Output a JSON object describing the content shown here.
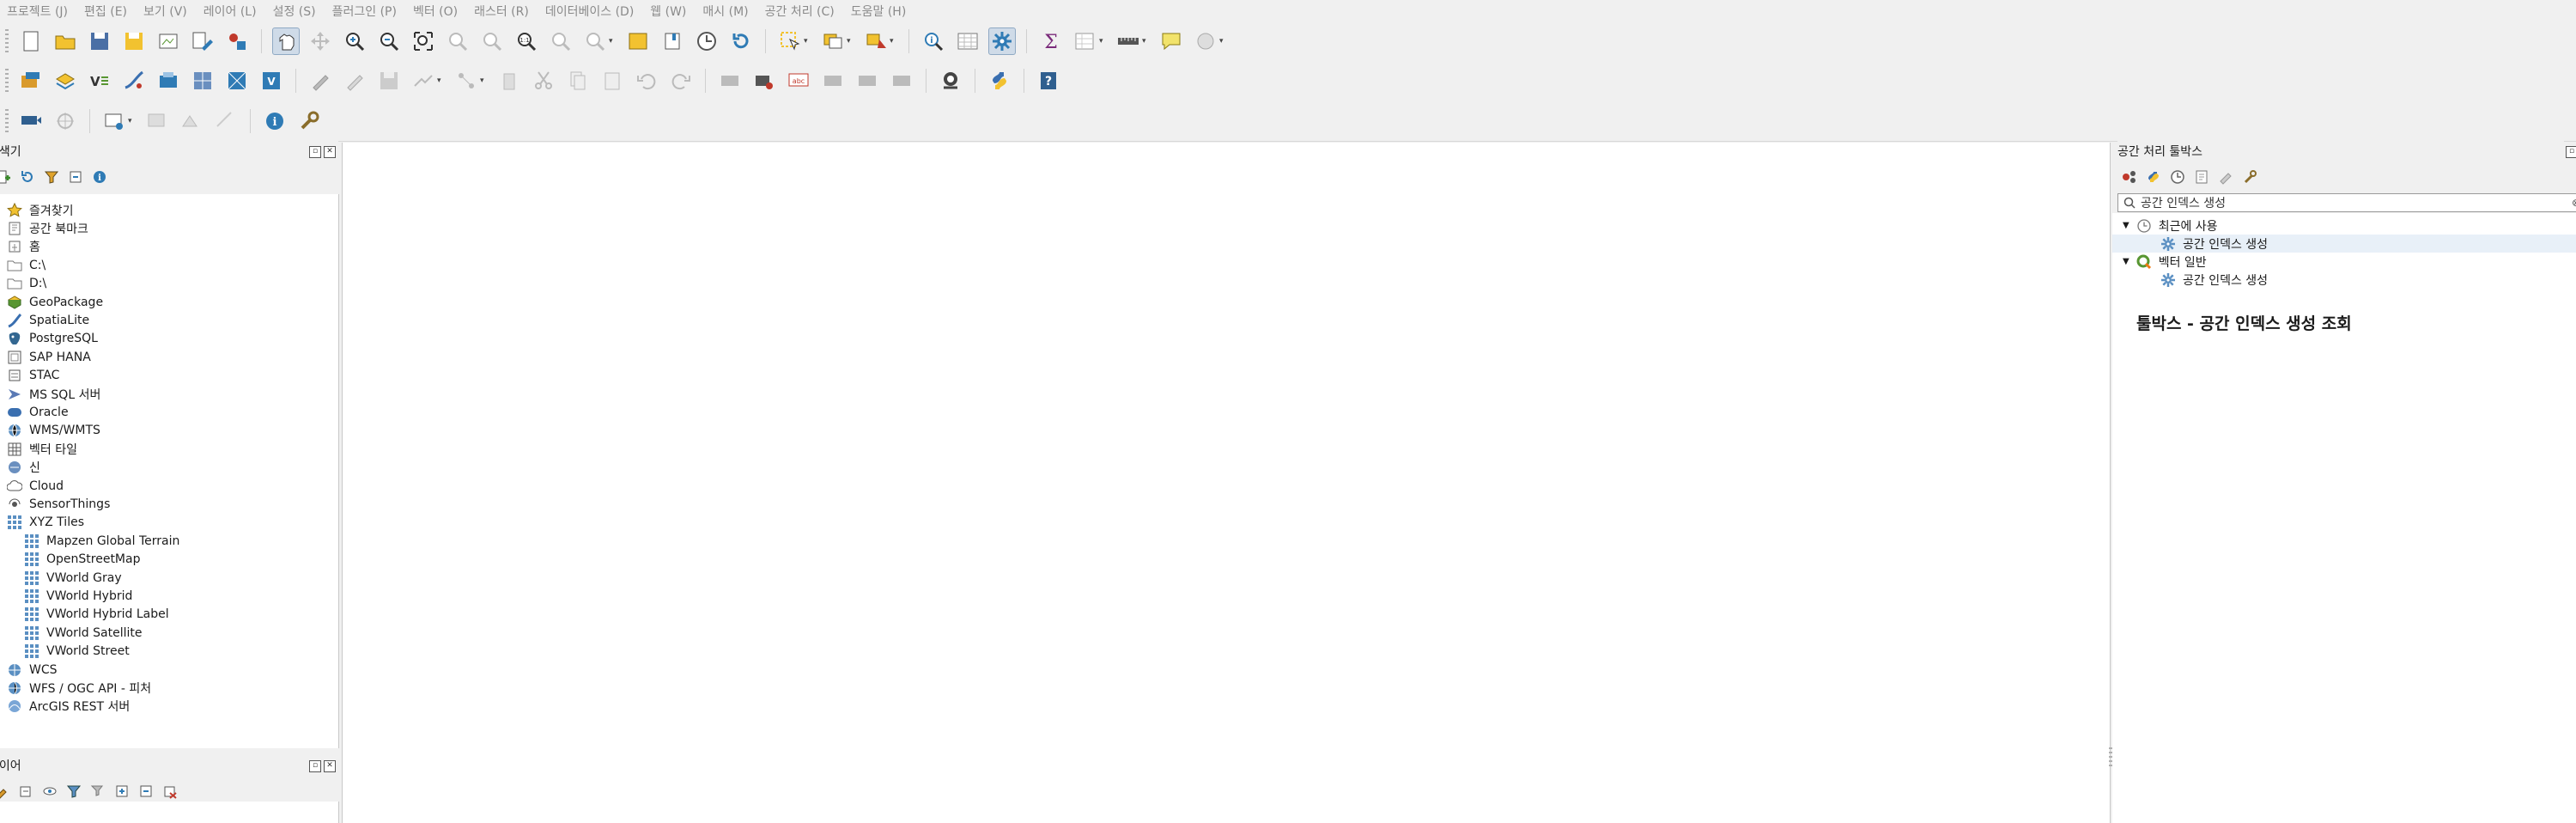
{
  "menubar": {
    "items": [
      "프로젝트 (J)",
      "편집 (E)",
      "보기 (V)",
      "레이어 (L)",
      "설정 (S)",
      "플러그인 (P)",
      "벡터 (O)",
      "래스터 (R)",
      "데이터베이스 (D)",
      "웹 (W)",
      "매시 (M)",
      "공간 처리 (C)",
      "도움말 (H)"
    ]
  },
  "toolbar_icons": {
    "row1": [
      "new-project",
      "open-project",
      "save-project",
      "save-as",
      "print-layout",
      "layout-manager",
      "style-manager",
      "pan-map",
      "pan-to-selection",
      "zoom-in",
      "zoom-out",
      "zoom-full",
      "zoom-to-selection",
      "zoom-to-layer",
      "zoom-native",
      "zoom-last",
      "zoom-next",
      "new-bookmark",
      "show-bookmarks",
      "temporal-controller",
      "refresh",
      "select-features",
      "deselect",
      "select-by-location",
      "identify",
      "attribute-table",
      "processing-toolbox",
      "statistical-summary",
      "open-table",
      "measure",
      "map-tips",
      "annotation"
    ],
    "row2": [
      "data-source-manager",
      "add-vector-layer",
      "add-delimited-text",
      "add-spatialite",
      "add-virtual-layer",
      "add-raster",
      "add-mesh",
      "add-wms",
      "current-edits",
      "toggle-editing",
      "save-edits",
      "digitize",
      "vertex-tool",
      "delete-selected",
      "cut",
      "copy",
      "paste",
      "undo",
      "redo",
      "label-tool",
      "pin-labels",
      "show-labels",
      "move-label",
      "rotate-label",
      "change-label",
      "qgis-online",
      "python-console",
      "help"
    ],
    "row3": [
      "move-feature",
      "rotate",
      "add-ring",
      "add-part",
      "fill-ring",
      "split",
      "information",
      "settings-tool"
    ]
  },
  "browser": {
    "title": "탐색기",
    "items": [
      {
        "label": "즐겨찾기",
        "icon": "star-icon",
        "indent": 0
      },
      {
        "label": "공간 북마크",
        "icon": "bookmark-icon",
        "indent": 0
      },
      {
        "label": "홈",
        "icon": "home-icon",
        "indent": 0
      },
      {
        "label": "C:\\",
        "icon": "folder-icon",
        "indent": 0
      },
      {
        "label": "D:\\",
        "icon": "folder-icon",
        "indent": 0
      },
      {
        "label": "GeoPackage",
        "icon": "geopackage-icon",
        "indent": 0
      },
      {
        "label": "SpatiaLite",
        "icon": "spatialite-icon",
        "indent": 0
      },
      {
        "label": "PostgreSQL",
        "icon": "postgresql-icon",
        "indent": 0
      },
      {
        "label": "SAP HANA",
        "icon": "sap-hana-icon",
        "indent": 0
      },
      {
        "label": "STAC",
        "icon": "stac-icon",
        "indent": 0
      },
      {
        "label": "MS SQL 서버",
        "icon": "mssql-icon",
        "indent": 0
      },
      {
        "label": "Oracle",
        "icon": "oracle-icon",
        "indent": 0
      },
      {
        "label": "WMS/WMTS",
        "icon": "wms-icon",
        "indent": 0
      },
      {
        "label": "벡터 타일",
        "icon": "vector-tile-icon",
        "indent": 0
      },
      {
        "label": "신",
        "icon": "scene-icon",
        "indent": 0
      },
      {
        "label": "Cloud",
        "icon": "cloud-icon",
        "indent": 0
      },
      {
        "label": "SensorThings",
        "icon": "sensorthings-icon",
        "indent": 0
      },
      {
        "label": "XYZ Tiles",
        "icon": "xyz-tiles-icon",
        "indent": 0
      },
      {
        "label": "Mapzen Global Terrain",
        "icon": "xyz-tiles-icon",
        "indent": 1
      },
      {
        "label": "OpenStreetMap",
        "icon": "xyz-tiles-icon",
        "indent": 1
      },
      {
        "label": "VWorld Gray",
        "icon": "xyz-tiles-icon",
        "indent": 1
      },
      {
        "label": "VWorld Hybrid",
        "icon": "xyz-tiles-icon",
        "indent": 1
      },
      {
        "label": "VWorld Hybrid Label",
        "icon": "xyz-tiles-icon",
        "indent": 1
      },
      {
        "label": "VWorld Satellite",
        "icon": "xyz-tiles-icon",
        "indent": 1
      },
      {
        "label": "VWorld Street",
        "icon": "xyz-tiles-icon",
        "indent": 1
      },
      {
        "label": "WCS",
        "icon": "wcs-icon",
        "indent": 0
      },
      {
        "label": "WFS / OGC API - 피처",
        "icon": "wfs-icon",
        "indent": 0
      },
      {
        "label": "ArcGIS REST 서버",
        "icon": "arcgis-icon",
        "indent": 0
      }
    ]
  },
  "layers": {
    "title": "레이어"
  },
  "toolbox": {
    "title": "공간 처리 툴박스",
    "search_value": "공간 인덱스 생성",
    "groups": [
      {
        "label": "최근에 사용",
        "icon": "clock-icon",
        "child": "공간 인덱스 생성"
      },
      {
        "label": "벡터 일반",
        "icon": "qgis-q-icon",
        "child": "공간 인덱스 생성"
      }
    ],
    "help_title": "툴박스 - 공간 인덱스 생성 조회"
  },
  "colors": {
    "accent": "#589632",
    "selection": "#e8f0f8",
    "menu_text": "#8a8a8a"
  }
}
